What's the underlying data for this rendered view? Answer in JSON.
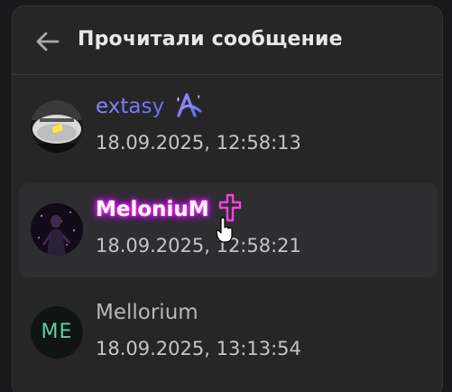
{
  "header": {
    "back_icon": "arrow-left-icon",
    "title": "Прочитали сообщение"
  },
  "readers": [
    {
      "name": "extasy",
      "badge_icon": "sparkle-a-icon",
      "name_color": "#7b7bff",
      "timestamp": "18.09.2025, 12:58:13"
    },
    {
      "name": "MeloniuM",
      "badge_icon": "cross-icon",
      "name_color": "#ff2ee0",
      "timestamp": "18.09.2025, 12:58:21",
      "hovered": true
    },
    {
      "name": "Mellorium",
      "avatar_initials": "ME",
      "name_color": "#b7b7ba",
      "timestamp": "18.09.2025, 13:13:54"
    }
  ],
  "colors": {
    "panel_bg": "#262627",
    "hover_bg": "#2e2e30",
    "initials_color": "#5fd0a2"
  }
}
